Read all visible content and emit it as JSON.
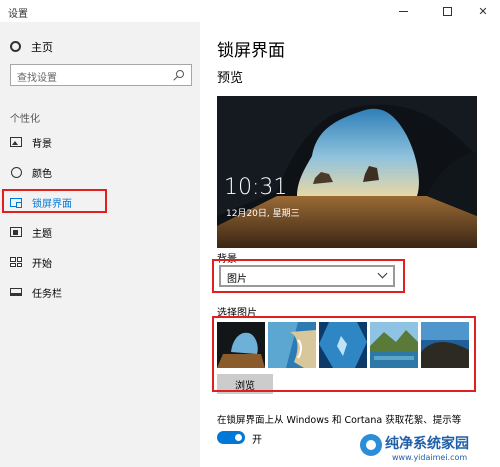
{
  "window": {
    "title": "设置"
  },
  "sidebar": {
    "home_label": "主页",
    "search_placeholder": "查找设置",
    "section_label": "个性化",
    "items": [
      {
        "label": "背景",
        "icon": "picture-icon",
        "active": false
      },
      {
        "label": "颜色",
        "icon": "palette-icon",
        "active": false
      },
      {
        "label": "锁屏界面",
        "icon": "lockscreen-icon",
        "active": true
      },
      {
        "label": "主题",
        "icon": "theme-icon",
        "active": false
      },
      {
        "label": "开始",
        "icon": "start-icon",
        "active": false
      },
      {
        "label": "任务栏",
        "icon": "taskbar-icon",
        "active": false
      }
    ]
  },
  "main": {
    "title": "锁屏界面",
    "preview_label": "预览",
    "preview_time": "10:31",
    "preview_date": "12月20日, 星期三",
    "background_label": "背景",
    "background_value": "图片",
    "choose_picture_label": "选择图片",
    "browse_label": "浏览",
    "tip_text": "在锁屏界面上从 Windows 和 Cortana 获取花絮、提示等",
    "toggle_label": "开",
    "toggle_on": true
  },
  "watermark": {
    "brand": "纯净系统家园",
    "url": "www.yidaimei.com"
  },
  "colors": {
    "accent": "#0078d7",
    "highlight": "#e02020",
    "sidebar_bg": "#f2f2f2"
  }
}
